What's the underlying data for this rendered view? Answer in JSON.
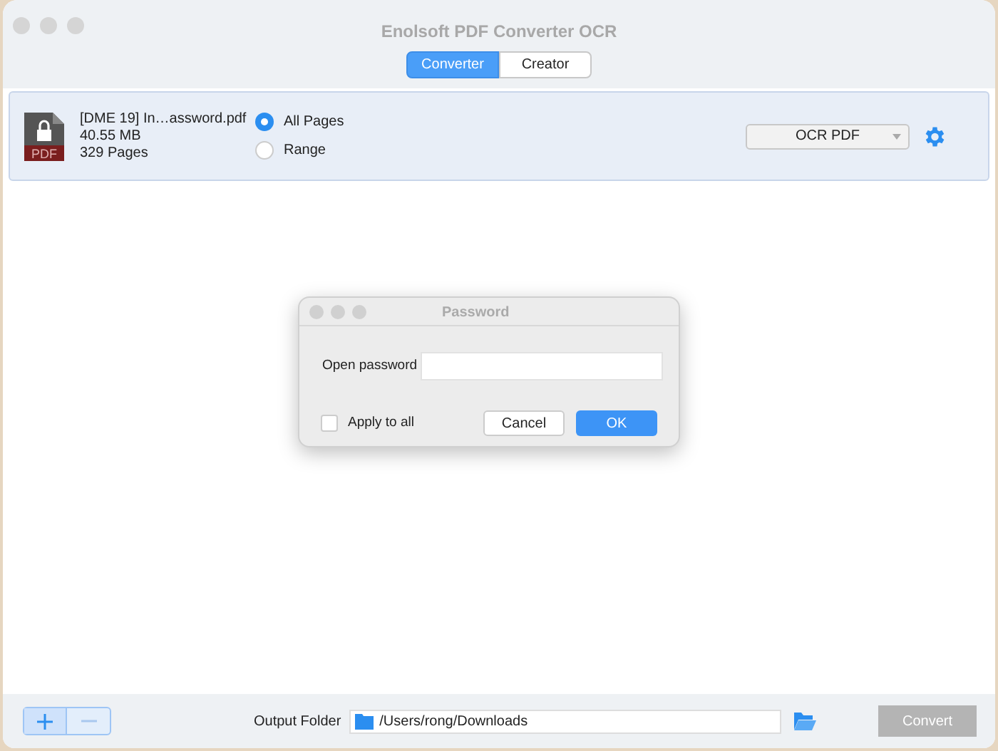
{
  "window": {
    "title": "Enolsoft PDF Converter OCR"
  },
  "tabs": [
    {
      "label": "Converter",
      "selected": true
    },
    {
      "label": "Creator",
      "selected": false
    }
  ],
  "file": {
    "name": "[DME 19] In…assword.pdf",
    "size": "40.55 MB",
    "pages": "329 Pages",
    "icon_label": "PDF",
    "page_options": [
      {
        "label": "All Pages",
        "selected": true
      },
      {
        "label": "Range",
        "selected": false
      }
    ],
    "format": "OCR PDF"
  },
  "dialog": {
    "title": "Password",
    "field_label": "Open password",
    "apply_all": {
      "label": "Apply to all",
      "checked": false
    },
    "buttons": [
      "Cancel",
      "OK"
    ]
  },
  "footer": {
    "output_label": "Output Folder",
    "output_path": "/Users/rong/Downloads",
    "convert": {
      "label": "Convert",
      "disabled": true
    }
  }
}
